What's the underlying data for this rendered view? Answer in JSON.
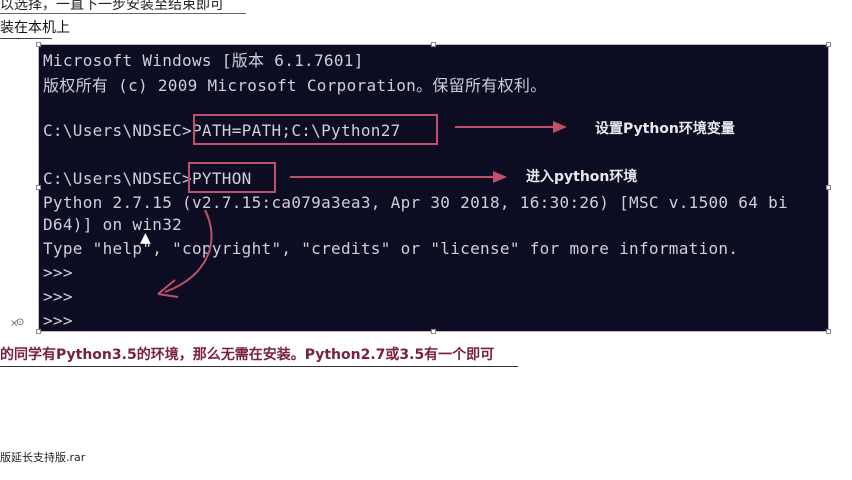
{
  "header": {
    "top_text": "以选择，一直下一步安装至结束即可",
    "subtitle": "装在本机上"
  },
  "console": {
    "lines": [
      "Microsoft Windows [版本 6.1.7601]",
      "版权所有 (c) 2009 Microsoft Corporation。保留所有权利。",
      "",
      "C:\\Users\\NDSEC>PATH=PATH;C:\\Python27",
      "",
      "C:\\Users\\NDSEC>PYTHON",
      "Python 2.7.15 (v2.7.15:ca079a3ea3, Apr 30 2018, 16:30:26) [MSC v.1500 64 bi",
      "D64)] on win32",
      "Type \"help\", \"copyright\", \"credits\" or \"license\" for more information.",
      ">>>",
      ">>>",
      ">>>"
    ]
  },
  "annotations": {
    "set_env": "设置Python环境变量",
    "enter_env": "进入python环境"
  },
  "note": "的同学有Python3.5的环境，那么无需在安装。Python2.7或3.5有一个即可",
  "file_label": "版延长支持版.rar",
  "colors": {
    "console_bg": "#0c0c22",
    "annotation_red": "#c0506a"
  }
}
